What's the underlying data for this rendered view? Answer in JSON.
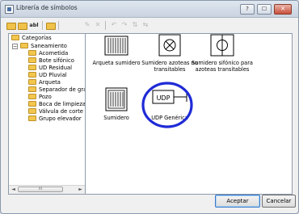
{
  "window": {
    "title": "Librería de símbolos",
    "controls": [
      "?",
      "☐",
      "✕"
    ]
  },
  "toolbar": {
    "items": [
      {
        "icon": "folder-icon"
      },
      {
        "icon": "folder-open-icon"
      },
      {
        "icon": "rename-icon",
        "text": "abl"
      },
      {
        "icon": "folder-new-icon"
      },
      {
        "icon": "edit-icon",
        "text": "✎"
      },
      {
        "icon": "delete-icon",
        "text": "✕"
      },
      {
        "icon": "rotate-left-icon",
        "text": "↶"
      },
      {
        "icon": "rotate-right-icon",
        "text": "↷"
      },
      {
        "icon": "flip-icon",
        "text": "⇅"
      },
      {
        "icon": "mirror-icon",
        "text": "⇆"
      }
    ]
  },
  "tree": {
    "root": "Categorías",
    "category": "Saneamiento",
    "items": [
      "Acometida",
      "Bote sifónico",
      "UD Residual",
      "UD Pluvial",
      "Arqueta",
      "Separador de gra",
      "Pozo",
      "Boca de limpieza",
      "Válvula de corte",
      "Grupo elevador"
    ],
    "scroll": {
      "left": "◄",
      "right": "►",
      "thumb": "III"
    }
  },
  "symbols": [
    {
      "label": "Arqueta sumidero"
    },
    {
      "label": "Sumidero azoteas no transitables"
    },
    {
      "label": "Sumidero sifónico para azoteas transitables"
    },
    {
      "label": "Sumidero"
    },
    {
      "label": "UDP Genérica",
      "glyph": "UDP"
    }
  ],
  "buttons": {
    "accept": "Aceptar",
    "cancel": "Cancelar"
  },
  "colors": {
    "selection_circle": "#1f2bd6",
    "folder": "#f3c64e"
  }
}
